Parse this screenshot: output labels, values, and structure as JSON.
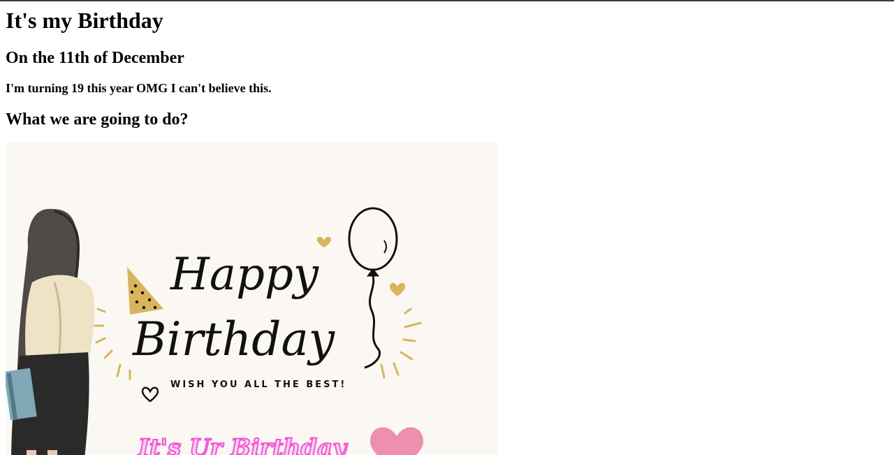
{
  "page": {
    "title": "It's my Birthday",
    "subtitle": "On the 11th of December",
    "note": "I'm turning 19 this year OMG I can't believe this.",
    "section_heading": "What we are going to do?"
  },
  "image": {
    "script_line_1": "Happy",
    "script_line_2": "Birthday",
    "tagline": "WISH YOU ALL THE BEST!",
    "neon_text": "It's Ur Birthday",
    "colors": {
      "background": "#fbf8f4",
      "gold": "#d9b45a",
      "ink": "#111111",
      "pink": "#ef8fb0",
      "neon": "#ff4fd8"
    }
  }
}
